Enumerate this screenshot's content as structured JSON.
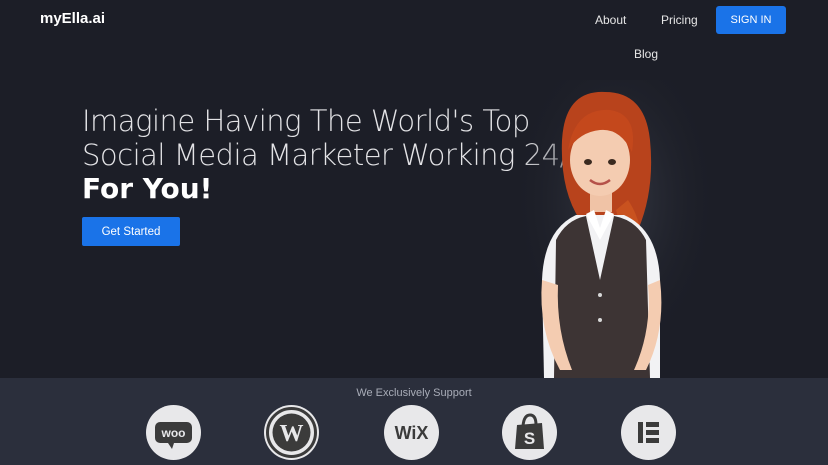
{
  "header": {
    "logo": "myElla.ai",
    "nav": {
      "about": "About",
      "pricing": "Pricing",
      "blog": "Blog"
    },
    "signin_label": "SIGN IN"
  },
  "hero": {
    "line1": "Imagine Having The World's Top",
    "line2": "Social Media Marketer Working 24/7",
    "line3": "For You!",
    "cta_label": "Get Started"
  },
  "support": {
    "title": "We Exclusively Support",
    "logos": [
      {
        "icon": "woocommerce-icon",
        "text": "woo"
      },
      {
        "icon": "wordpress-icon",
        "text": "W"
      },
      {
        "icon": "wix-icon",
        "text": "WiX"
      },
      {
        "icon": "shopify-icon",
        "text": "S"
      },
      {
        "icon": "elementor-icon"
      }
    ]
  },
  "colors": {
    "background": "#1c1e27",
    "accent": "#1a73e8",
    "support_band": "#2b2f3c"
  }
}
